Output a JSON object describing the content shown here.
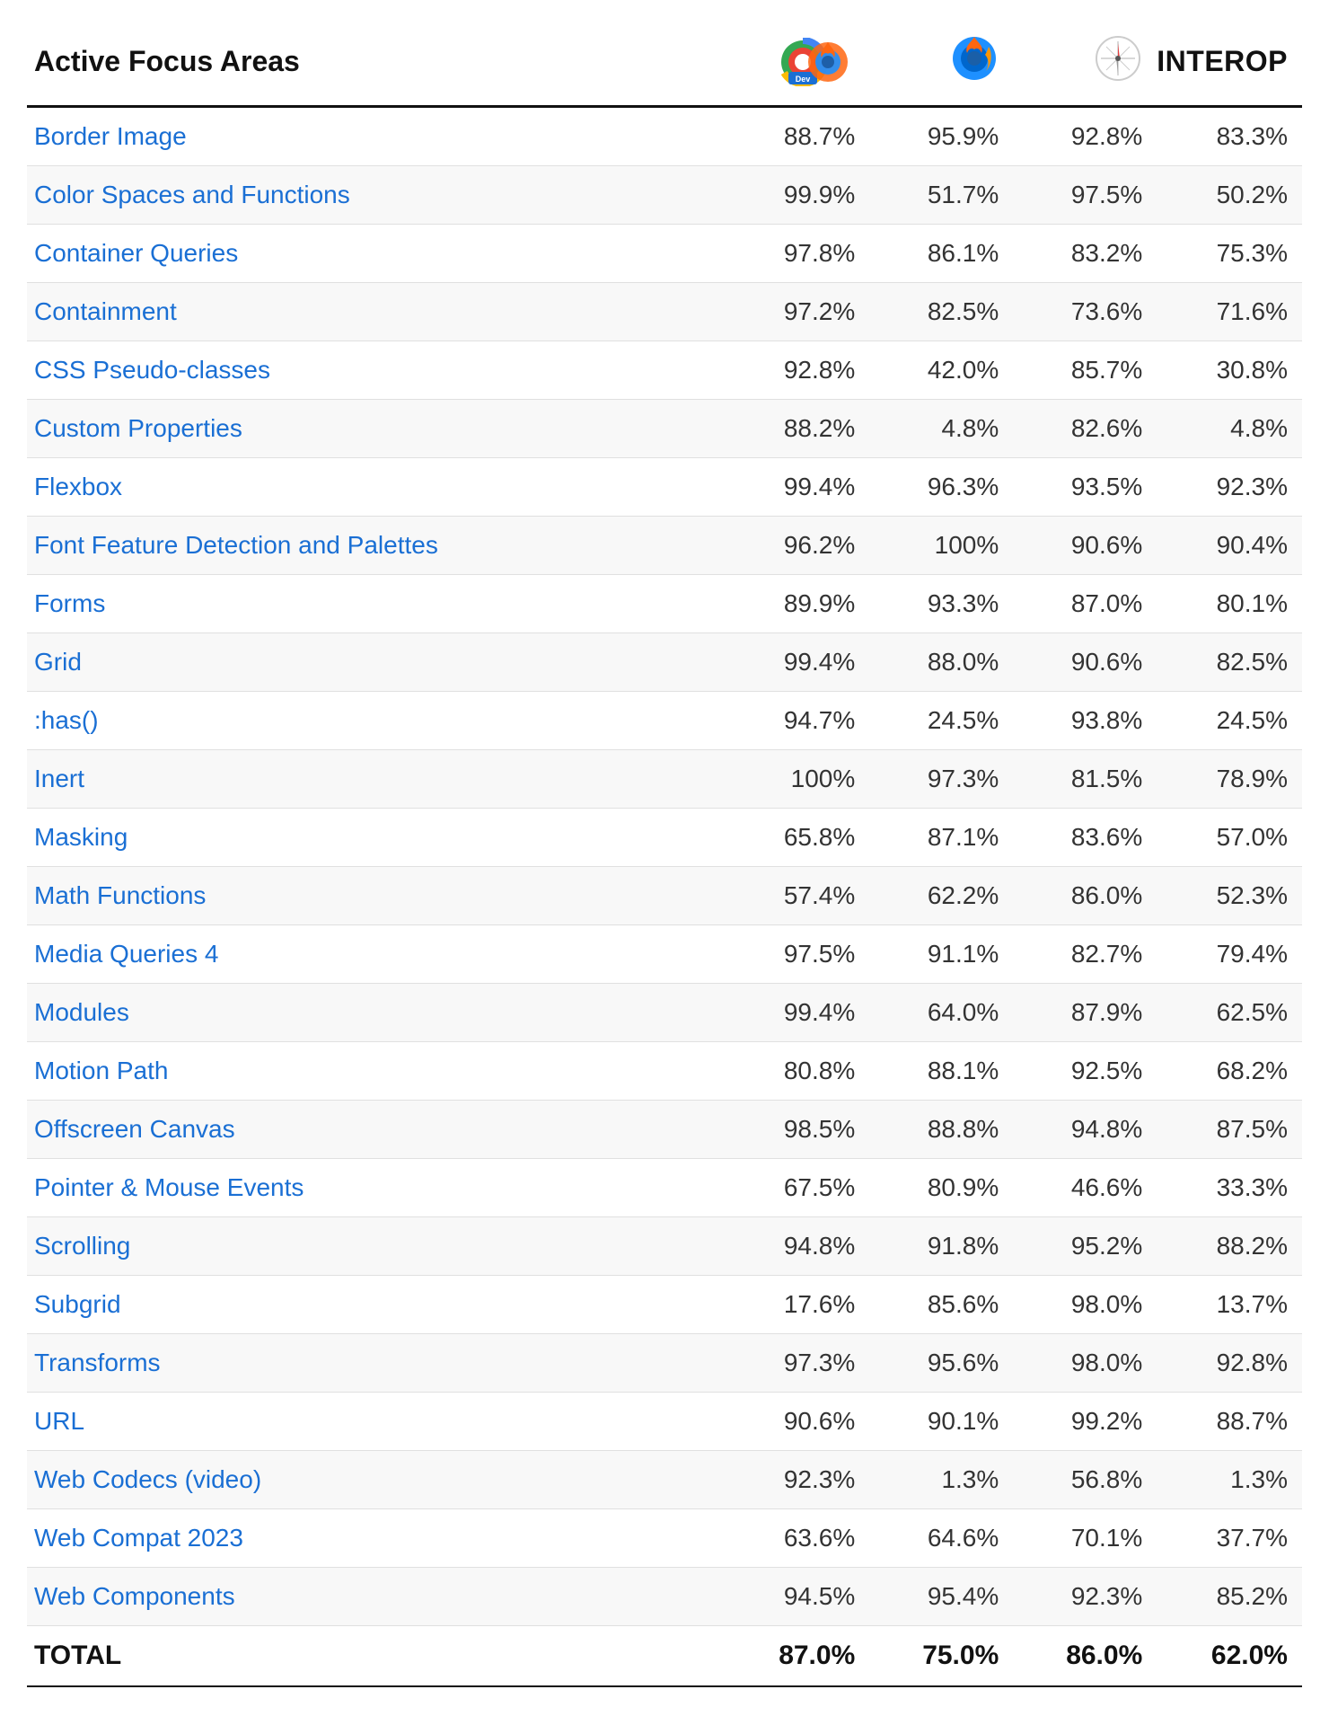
{
  "header": {
    "col_name": "Active Focus Areas",
    "col_chrome": "Chrome Dev",
    "col_firefox": "Firefox",
    "col_safari": "Safari",
    "col_interop": "INTEROP"
  },
  "rows": [
    {
      "name": "Border Image",
      "chrome": "88.7%",
      "firefox": "95.9%",
      "safari": "92.8%",
      "interop": "83.3%"
    },
    {
      "name": "Color Spaces and Functions",
      "chrome": "99.9%",
      "firefox": "51.7%",
      "safari": "97.5%",
      "interop": "50.2%"
    },
    {
      "name": "Container Queries",
      "chrome": "97.8%",
      "firefox": "86.1%",
      "safari": "83.2%",
      "interop": "75.3%"
    },
    {
      "name": "Containment",
      "chrome": "97.2%",
      "firefox": "82.5%",
      "safari": "73.6%",
      "interop": "71.6%"
    },
    {
      "name": "CSS Pseudo-classes",
      "chrome": "92.8%",
      "firefox": "42.0%",
      "safari": "85.7%",
      "interop": "30.8%"
    },
    {
      "name": "Custom Properties",
      "chrome": "88.2%",
      "firefox": "4.8%",
      "safari": "82.6%",
      "interop": "4.8%"
    },
    {
      "name": "Flexbox",
      "chrome": "99.4%",
      "firefox": "96.3%",
      "safari": "93.5%",
      "interop": "92.3%"
    },
    {
      "name": "Font Feature Detection and Palettes",
      "chrome": "96.2%",
      "firefox": "100%",
      "safari": "90.6%",
      "interop": "90.4%"
    },
    {
      "name": "Forms",
      "chrome": "89.9%",
      "firefox": "93.3%",
      "safari": "87.0%",
      "interop": "80.1%"
    },
    {
      "name": "Grid",
      "chrome": "99.4%",
      "firefox": "88.0%",
      "safari": "90.6%",
      "interop": "82.5%"
    },
    {
      "name": ":has()",
      "chrome": "94.7%",
      "firefox": "24.5%",
      "safari": "93.8%",
      "interop": "24.5%"
    },
    {
      "name": "Inert",
      "chrome": "100%",
      "firefox": "97.3%",
      "safari": "81.5%",
      "interop": "78.9%"
    },
    {
      "name": "Masking",
      "chrome": "65.8%",
      "firefox": "87.1%",
      "safari": "83.6%",
      "interop": "57.0%"
    },
    {
      "name": "Math Functions",
      "chrome": "57.4%",
      "firefox": "62.2%",
      "safari": "86.0%",
      "interop": "52.3%"
    },
    {
      "name": "Media Queries 4",
      "chrome": "97.5%",
      "firefox": "91.1%",
      "safari": "82.7%",
      "interop": "79.4%"
    },
    {
      "name": "Modules",
      "chrome": "99.4%",
      "firefox": "64.0%",
      "safari": "87.9%",
      "interop": "62.5%"
    },
    {
      "name": "Motion Path",
      "chrome": "80.8%",
      "firefox": "88.1%",
      "safari": "92.5%",
      "interop": "68.2%"
    },
    {
      "name": "Offscreen Canvas",
      "chrome": "98.5%",
      "firefox": "88.8%",
      "safari": "94.8%",
      "interop": "87.5%"
    },
    {
      "name": "Pointer & Mouse Events",
      "chrome": "67.5%",
      "firefox": "80.9%",
      "safari": "46.6%",
      "interop": "33.3%"
    },
    {
      "name": "Scrolling",
      "chrome": "94.8%",
      "firefox": "91.8%",
      "safari": "95.2%",
      "interop": "88.2%"
    },
    {
      "name": "Subgrid",
      "chrome": "17.6%",
      "firefox": "85.6%",
      "safari": "98.0%",
      "interop": "13.7%"
    },
    {
      "name": "Transforms",
      "chrome": "97.3%",
      "firefox": "95.6%",
      "safari": "98.0%",
      "interop": "92.8%"
    },
    {
      "name": "URL",
      "chrome": "90.6%",
      "firefox": "90.1%",
      "safari": "99.2%",
      "interop": "88.7%"
    },
    {
      "name": "Web Codecs (video)",
      "chrome": "92.3%",
      "firefox": "1.3%",
      "safari": "56.8%",
      "interop": "1.3%"
    },
    {
      "name": "Web Compat 2023",
      "chrome": "63.6%",
      "firefox": "64.6%",
      "safari": "70.1%",
      "interop": "37.7%"
    },
    {
      "name": "Web Components",
      "chrome": "94.5%",
      "firefox": "95.4%",
      "safari": "92.3%",
      "interop": "85.2%"
    }
  ],
  "total": {
    "label": "TOTAL",
    "chrome": "87.0%",
    "firefox": "75.0%",
    "safari": "86.0%",
    "interop": "62.0%"
  }
}
